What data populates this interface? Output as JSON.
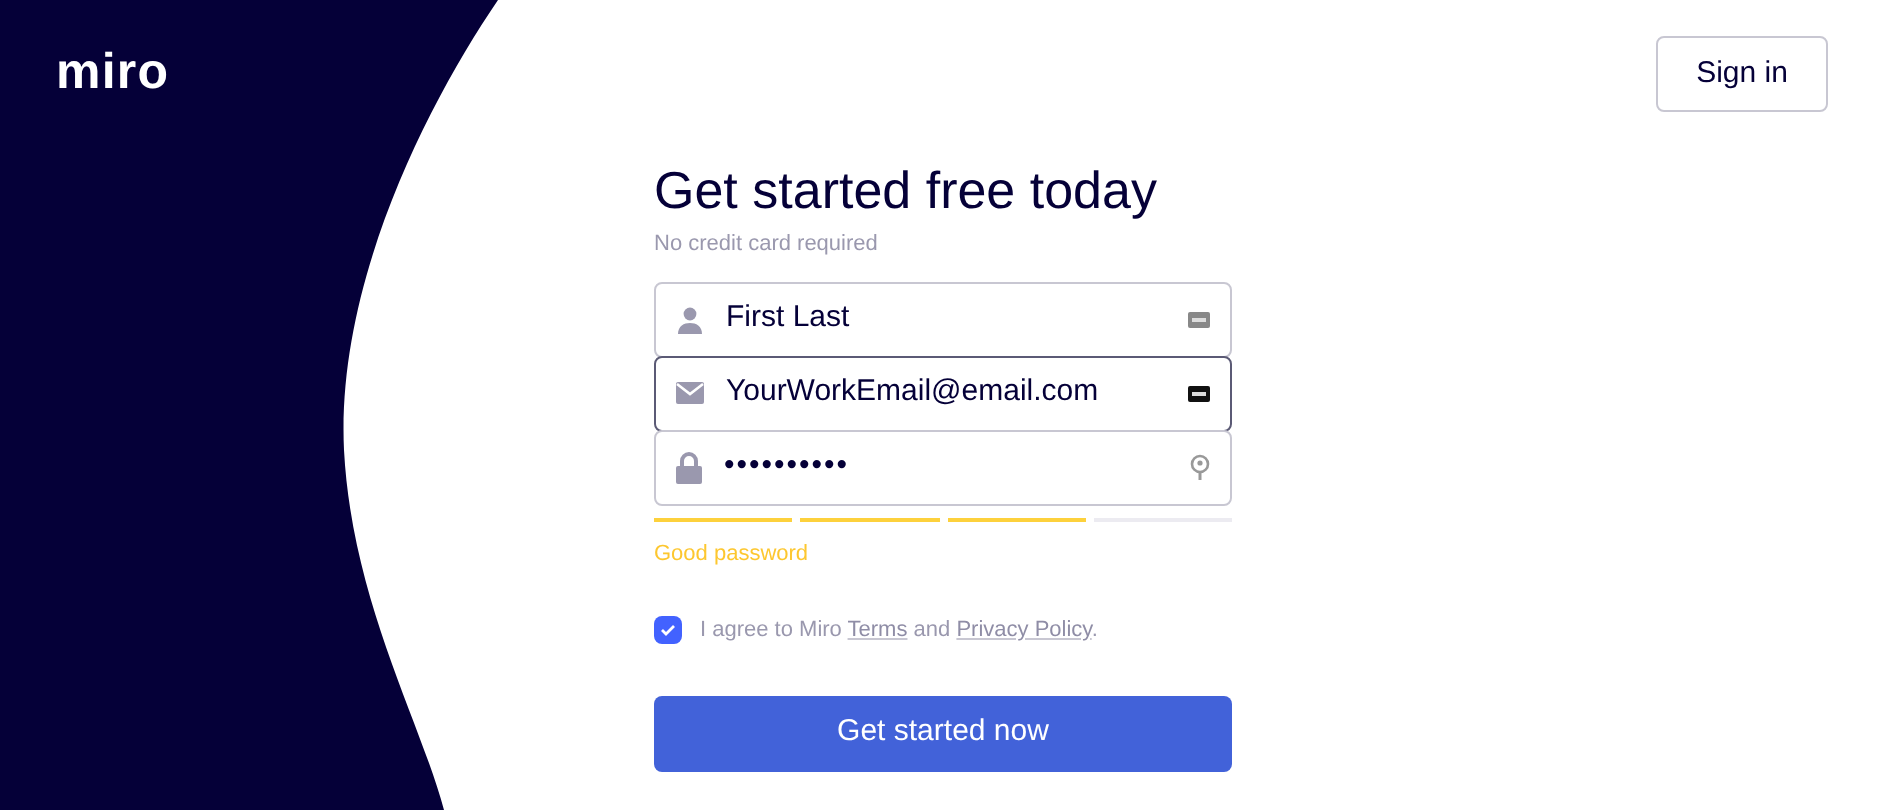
{
  "logo": "miro",
  "sign_in": "Sign in",
  "title": "Get started free today",
  "subtitle": "No credit card required",
  "fields": [
    {
      "kind": "name",
      "value": "First Last",
      "focused": false
    },
    {
      "kind": "email",
      "value": "YourWorkEmail@email.com",
      "focused": true
    },
    {
      "kind": "password",
      "value": "••••••••••",
      "focused": false
    }
  ],
  "password_strength": {
    "level": 0.75,
    "label": "Good password"
  },
  "agreement": {
    "checked": true,
    "parts": [
      {
        "kind": "text",
        "text": "I agree to Miro "
      },
      {
        "kind": "link",
        "text": "Terms"
      },
      {
        "kind": "text",
        "text": " and "
      },
      {
        "kind": "link",
        "text": "Privacy Policy"
      },
      {
        "kind": "text",
        "text": "."
      }
    ]
  },
  "submit": "Get started now"
}
